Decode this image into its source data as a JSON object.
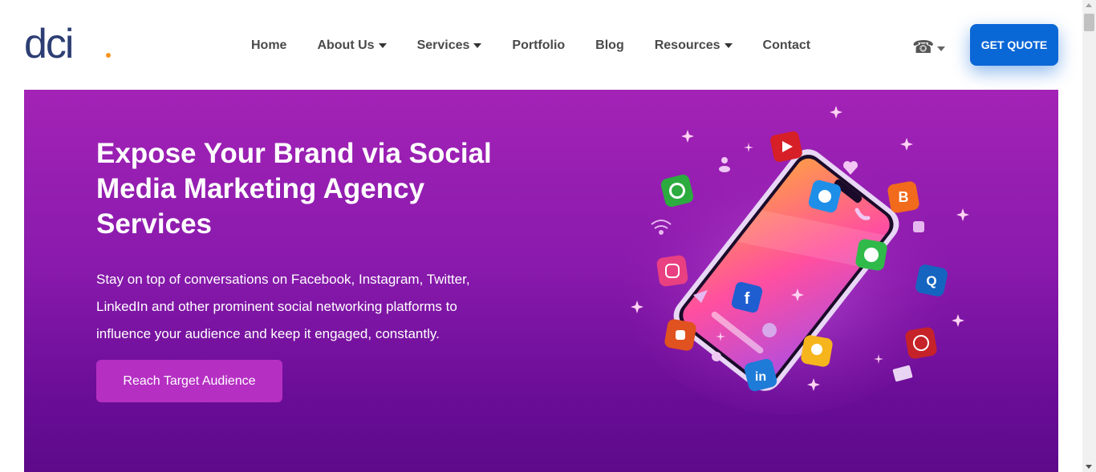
{
  "brand": {
    "logo_text": "dci",
    "accent_color": "#f7941d",
    "logo_color": "#2c3e73"
  },
  "nav": {
    "items": [
      {
        "label": "Home",
        "has_dropdown": false
      },
      {
        "label": "About Us",
        "has_dropdown": true
      },
      {
        "label": "Services",
        "has_dropdown": true
      },
      {
        "label": "Portfolio",
        "has_dropdown": false
      },
      {
        "label": "Blog",
        "has_dropdown": false
      },
      {
        "label": "Resources",
        "has_dropdown": true
      },
      {
        "label": "Contact",
        "has_dropdown": false
      }
    ],
    "phone_icon": "telephone-icon",
    "phone_glyph": "☎",
    "quote_label": "GET QUOTE",
    "quote_color": "#0a67d6"
  },
  "hero": {
    "title": "Expose Your Brand via Social Media Marketing Agency Services",
    "description": "Stay on top of conversations on Facebook, Instagram, Twitter, LinkedIn and other prominent social networking platforms to influence your audience and keep it engaged, constantly.",
    "cta_label": "Reach Target Audience",
    "cta_color": "#b52fc3",
    "bg_top_color": "#a323b6",
    "bg_bottom_color": "#5d0a8a",
    "illustration": {
      "device": "smartphone-illustration",
      "icons": [
        "youtube-icon",
        "twitter-icon",
        "blogger-icon",
        "spotify-icon",
        "whatsapp-icon",
        "instagram-icon",
        "quora-icon",
        "facebook-icon",
        "pinterest-icon",
        "snapchat-icon",
        "linkedin-icon",
        "thumbs-up-icon",
        "heart-icon",
        "user-icon",
        "phone-icon",
        "wifi-icon",
        "send-icon",
        "globe-icon",
        "location-icon",
        "mail-icon"
      ]
    }
  }
}
